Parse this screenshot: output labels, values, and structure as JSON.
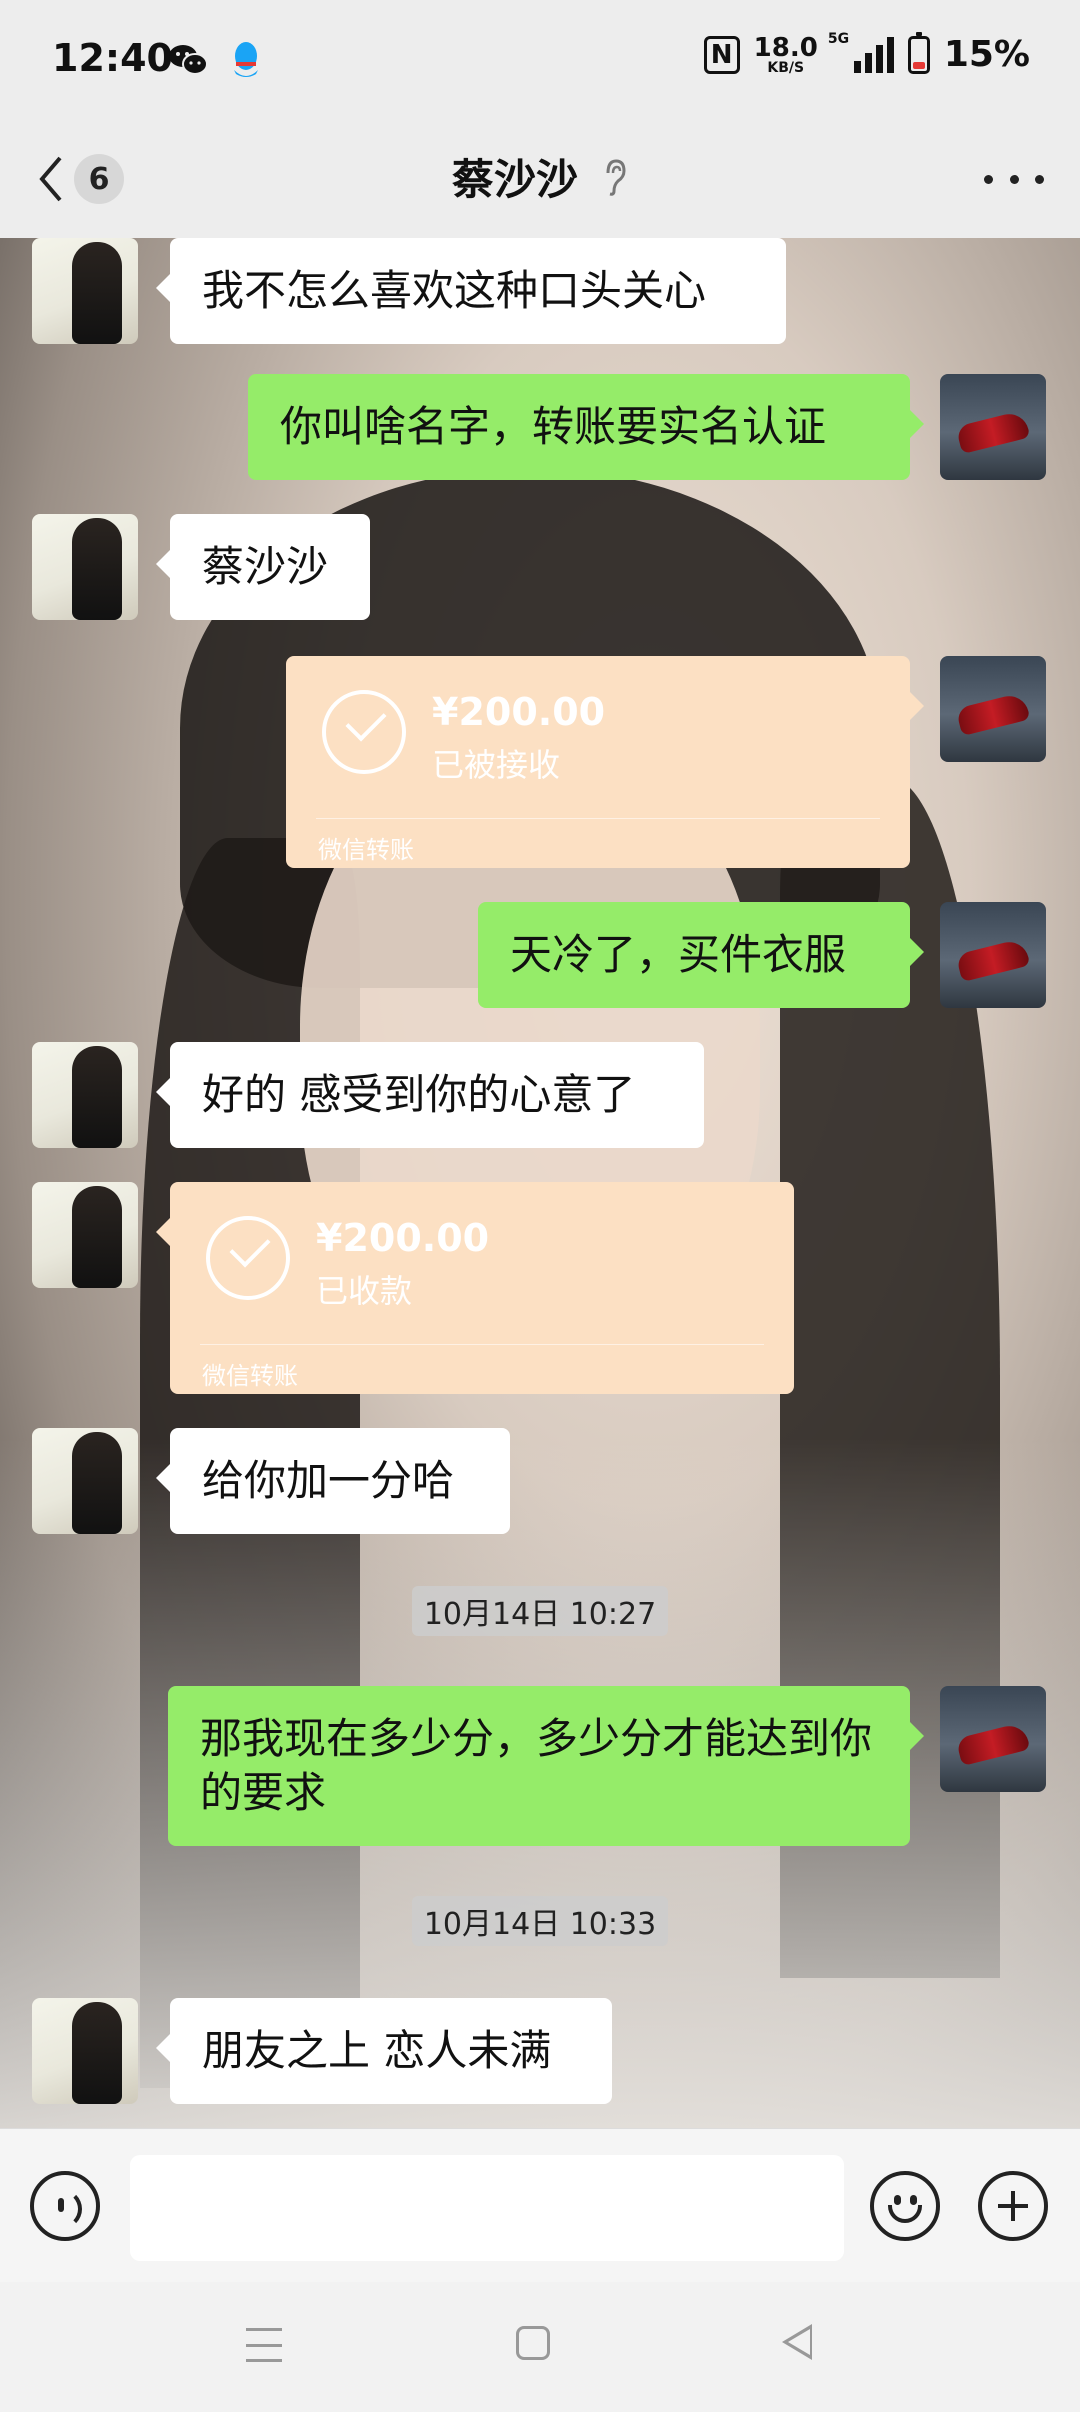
{
  "status_bar": {
    "time": "12:40",
    "net_speed": "18.0",
    "net_unit": "KB/S",
    "network_type": "5G",
    "battery_percent": "15%",
    "nfc_label": "N",
    "left_icons": [
      "wechat-icon",
      "qq-icon"
    ]
  },
  "header": {
    "unread_count": "6",
    "title": "蔡沙沙",
    "ear_icon": "ear-icon"
  },
  "messages": {
    "m1": "我不怎么喜欢这种口头关心",
    "m2": "你叫啥名字，转账要实名认证",
    "m3": "蔡沙沙",
    "t1_amount": "¥200.00",
    "t1_status": "已被接收",
    "t1_label": "微信转账",
    "m4": "天冷了，买件衣服",
    "m5": "好的 感受到你的心意了",
    "t2_amount": "¥200.00",
    "t2_status": "已收款",
    "t2_label": "微信转账",
    "m6": "给你加一分哈",
    "ts1": "10月14日 10:27",
    "m7": "那我现在多少分，多少分才能达到你的要求",
    "ts2": "10月14日 10:33",
    "m8": "朋友之上 恋人未满"
  },
  "input_bar": {
    "voice_icon": "voice-icon",
    "emoji_icon": "emoji-icon",
    "plus_icon": "plus-icon",
    "input_value": ""
  },
  "colors": {
    "green_bubble": "#95ec69",
    "white_bubble": "#ffffff",
    "transfer_bubble": "#fce0c3",
    "bar_bg": "#ededed"
  }
}
